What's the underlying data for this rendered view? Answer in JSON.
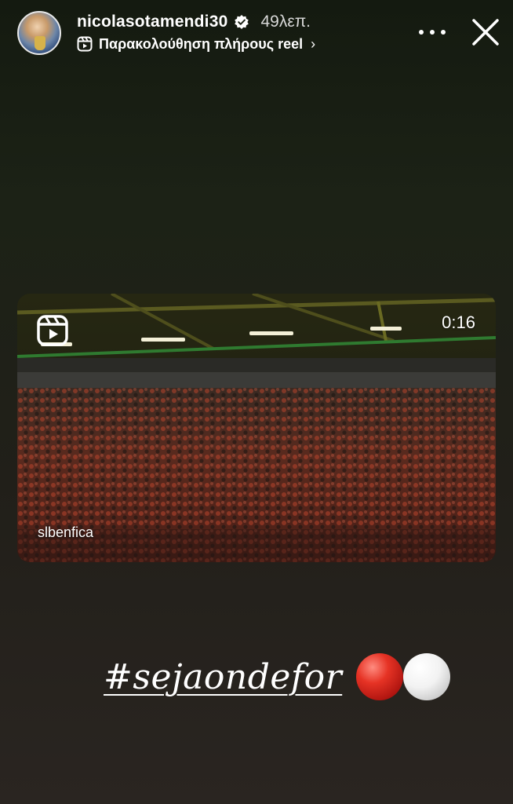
{
  "header": {
    "username": "nicolasotamendi30",
    "time_ago": "49λεπ.",
    "reel_link_label": "Παρακολούθηση πλήρους reel",
    "reel_link_chevron": "›"
  },
  "icons": {
    "verified": "verified-badge-icon",
    "reel": "reels-icon",
    "more": "more-options-icon",
    "close": "close-icon"
  },
  "video": {
    "duration": "0:16",
    "source_account": "slbenfica"
  },
  "caption": {
    "hashtag": "#sejaondefor",
    "emoji": [
      "red-circle",
      "white-circle"
    ]
  },
  "colors": {
    "background_top": "#141a10",
    "background_bottom": "#2a2521",
    "emoji_red": "#e63325",
    "emoji_white": "#f2f2f2"
  }
}
